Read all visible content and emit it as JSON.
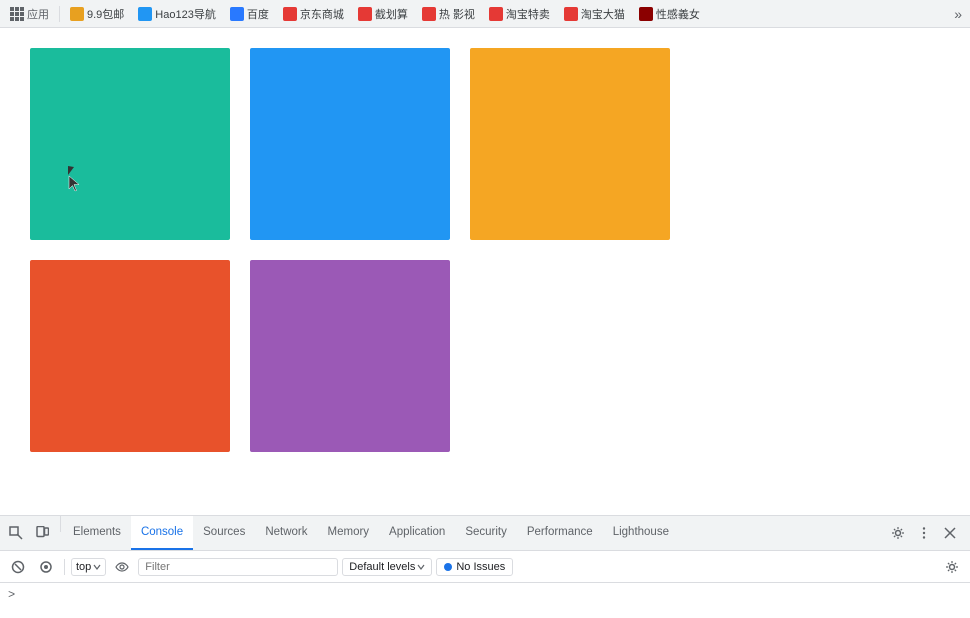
{
  "bookmark_bar": {
    "items": [
      {
        "label": "应用",
        "color": "#5f6368",
        "is_apps": true
      },
      {
        "label": "9.9包邮",
        "color": "#e8a020"
      },
      {
        "label": "Hao123导航",
        "color": "#2196f3"
      },
      {
        "label": "百度",
        "color": "#2979ff"
      },
      {
        "label": "京东商城",
        "color": "#e53935"
      },
      {
        "label": "截划算",
        "color": "#e53935"
      },
      {
        "label": "热 影视",
        "color": "#e53935"
      },
      {
        "label": "淘宝特卖",
        "color": "#e53935"
      },
      {
        "label": "淘宝大猫",
        "color": "#e53935"
      },
      {
        "label": "性感義女",
        "color": "#8b0000"
      }
    ]
  },
  "color_boxes": {
    "row1": [
      {
        "color": "#1abc9c",
        "name": "teal-box"
      },
      {
        "color": "#2196f3",
        "name": "blue-box"
      },
      {
        "color": "#f5a623",
        "name": "yellow-box"
      }
    ],
    "row2": [
      {
        "color": "#e8522b",
        "name": "red-box"
      },
      {
        "color": "#9b59b6",
        "name": "purple-box"
      }
    ]
  },
  "devtools": {
    "tabs": [
      {
        "label": "Elements",
        "active": false
      },
      {
        "label": "Console",
        "active": true
      },
      {
        "label": "Sources",
        "active": false
      },
      {
        "label": "Network",
        "active": false
      },
      {
        "label": "Memory",
        "active": false
      },
      {
        "label": "Application",
        "active": false
      },
      {
        "label": "Security",
        "active": false
      },
      {
        "label": "Performance",
        "active": false
      },
      {
        "label": "Lighthouse",
        "active": false
      }
    ],
    "toolbar": {
      "context_label": "top",
      "filter_placeholder": "Filter",
      "default_levels_label": "Default levels",
      "no_issues_label": "No Issues"
    },
    "console_prompt": ">"
  }
}
